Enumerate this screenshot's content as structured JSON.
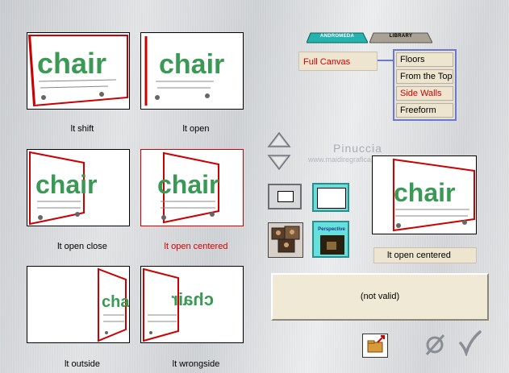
{
  "tabs": [
    {
      "label": "ANDROMEDA",
      "active": true
    },
    {
      "label": "LIBRARY",
      "active": false
    }
  ],
  "canvas_selector": {
    "value": "Full Canvas"
  },
  "categories": [
    {
      "label": "Floors",
      "selected": false
    },
    {
      "label": "From the Top",
      "selected": false
    },
    {
      "label": "Side Walls",
      "selected": true
    },
    {
      "label": "Freeform",
      "selected": false
    }
  ],
  "presets": [
    {
      "caption": "lt shift",
      "selected": false
    },
    {
      "caption": "lt open",
      "selected": false
    },
    {
      "caption": "lt open close",
      "selected": false
    },
    {
      "caption": "lt open centered",
      "selected": true
    },
    {
      "caption": "lt outside",
      "selected": false
    },
    {
      "caption": "lt wrongside",
      "selected": false
    }
  ],
  "thumbnail_word": "chair",
  "current_preset": "lt open centered",
  "status": "(not valid)",
  "image_button_label": "Perspective",
  "watermark": {
    "line1": "Pinuccia",
    "line2": "www.maidiregrafica.eu"
  },
  "colors": {
    "accent_red": "#d40000",
    "menu_border": "#6a78d4",
    "box_bg": "#ede5cf",
    "word_green": "#3a9a55",
    "teal": "#66e0dc"
  }
}
